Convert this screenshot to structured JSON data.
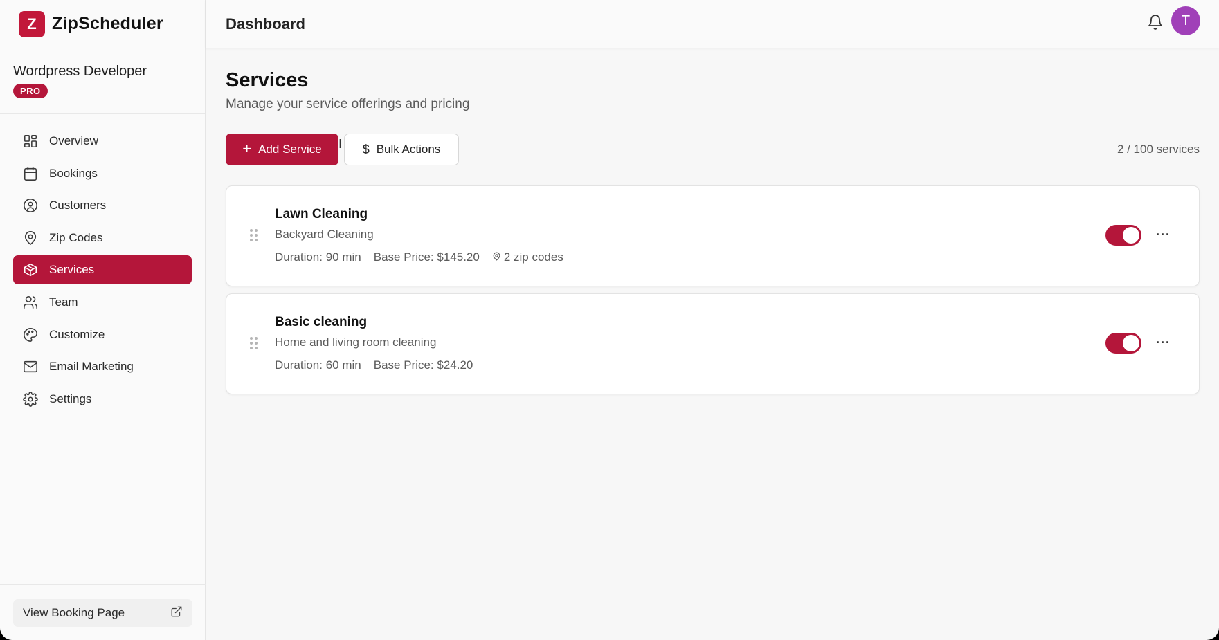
{
  "app": {
    "name": "ZipScheduler",
    "logo_letter": "Z"
  },
  "account": {
    "name": "Wordpress Developer",
    "plan_badge": "PRO"
  },
  "sidebar": {
    "items": [
      {
        "label": "Overview",
        "icon": "grid-icon"
      },
      {
        "label": "Bookings",
        "icon": "calendar-icon"
      },
      {
        "label": "Customers",
        "icon": "user-circle-icon"
      },
      {
        "label": "Zip Codes",
        "icon": "map-pin-icon"
      },
      {
        "label": "Services",
        "icon": "package-icon",
        "active": true
      },
      {
        "label": "Team",
        "icon": "users-icon"
      },
      {
        "label": "Customize",
        "icon": "palette-icon"
      },
      {
        "label": "Email Marketing",
        "icon": "mail-icon"
      },
      {
        "label": "Settings",
        "icon": "gear-icon"
      }
    ],
    "view_booking_label": "View Booking Page"
  },
  "header": {
    "title": "Dashboard",
    "avatar_letter": "T"
  },
  "main": {
    "title": "Services",
    "subtitle": "Manage your service offerings and pricing",
    "add_button": "Add Service",
    "bulk_button": "Bulk Actions",
    "count": "2 / 100 services",
    "services": [
      {
        "name": "Lawn Cleaning",
        "description": "Backyard Cleaning",
        "duration": "Duration: 90 min",
        "price": "Base Price: $145.20",
        "zip_codes": "2 zip codes",
        "enabled": true
      },
      {
        "name": "Basic cleaning",
        "description": "Home and living room cleaning",
        "duration": "Duration: 60 min",
        "price": "Base Price: $24.20",
        "enabled": true
      }
    ]
  },
  "colors": {
    "accent": "#b4163a",
    "avatar": "#a040b8"
  }
}
